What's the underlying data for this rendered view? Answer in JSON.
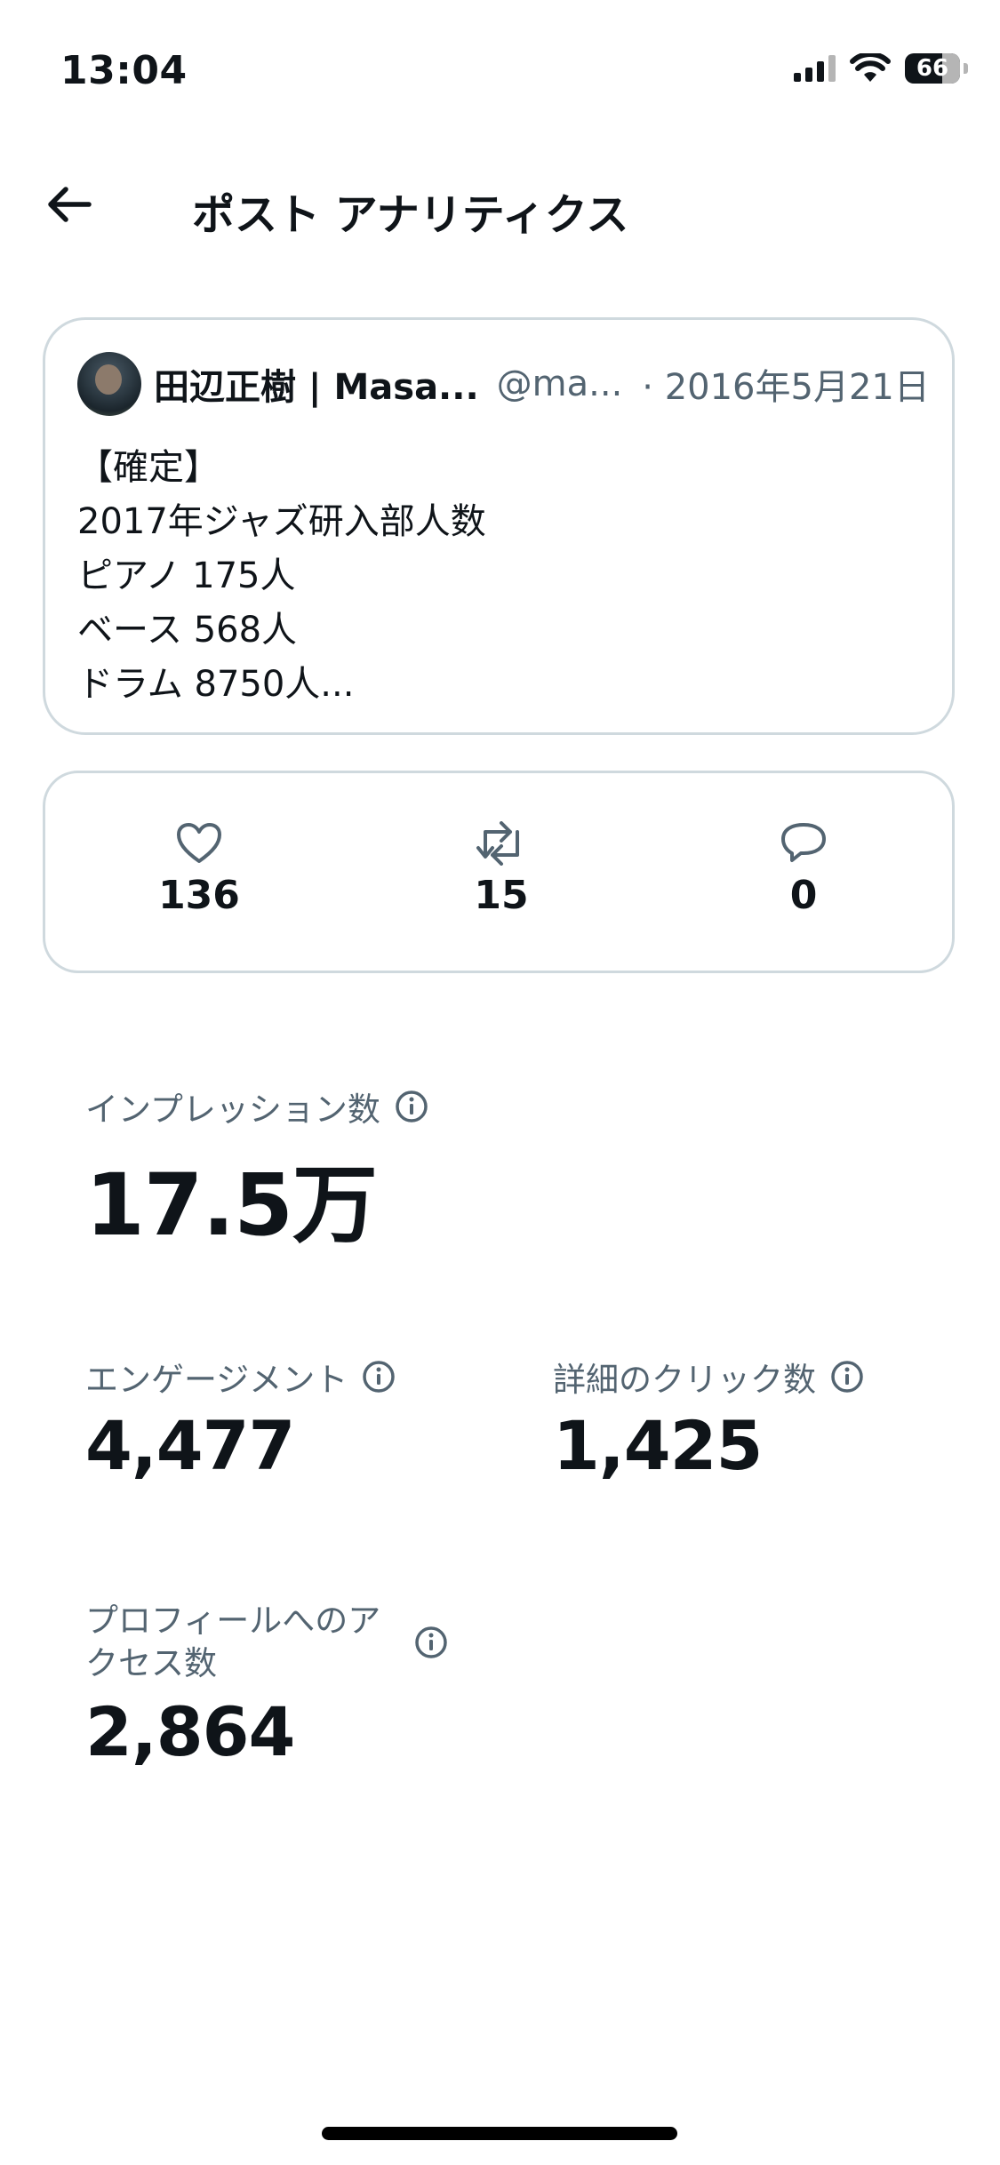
{
  "status_bar": {
    "time": "13:04",
    "battery": "66"
  },
  "header": {
    "title": "ポスト アナリティクス",
    "back_icon": "arrow-left-icon"
  },
  "tweet": {
    "author_name": "田辺正樹 | Masa...",
    "handle": "@ma...",
    "date": "· 2016年5月21日",
    "lines": [
      "【確定】",
      "2017年ジャズ研入部人数",
      "ピアノ 175人",
      "ベース 568人",
      "ドラム 8750人..."
    ]
  },
  "engagement": {
    "likes": "136",
    "reposts": "15",
    "replies": "0"
  },
  "metrics": {
    "impressions": {
      "label": "インプレッション数",
      "value": "17.5万"
    },
    "engagements": {
      "label": "エンゲージメント",
      "value": "4,477"
    },
    "detail_clicks": {
      "label": "詳細のクリック数",
      "value": "1,425"
    },
    "profile_visits": {
      "label_line1": "プロフィールへのア",
      "label_line2": "クセス数",
      "value": "2,864"
    }
  },
  "colors": {
    "text_primary": "#0f1419",
    "text_secondary": "#536471",
    "border": "#cfd9de"
  }
}
